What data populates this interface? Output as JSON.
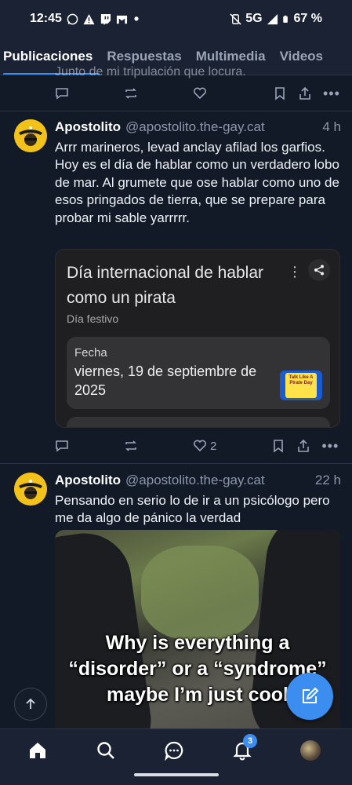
{
  "status_bar": {
    "time": "12:45",
    "network": "5G",
    "battery": "67 %"
  },
  "tabs": [
    "Publicaciones",
    "Respuestas",
    "Multimedia",
    "Videos"
  ],
  "previous_post": {
    "partial_text": "Junto de mi tripulación que locura."
  },
  "posts": [
    {
      "author": "Apostolito",
      "handle": "@apostolito.the-gay.cat",
      "time": "4 h",
      "text": "Arrr marineros, levad anclay afilad los garfios. Hoy es el día de hablar como un verdadero lobo de mar. Al grumete que ose hablar como uno de esos pringados de tierra, que se prepare para probar mi sable yarrrrr.",
      "card": {
        "title": "Día internacional de hablar como un pirata",
        "subtitle": "Día festivo",
        "field_label": "Fecha",
        "field_value": "viernes, 19 de septiembre de 2025",
        "thumb_text": "Talk Like A Pirate Day"
      },
      "likes": "2"
    },
    {
      "author": "Apostolito",
      "handle": "@apostolito.the-gay.cat",
      "time": "22 h",
      "text": "Pensando en serio lo de ir a un psicólogo pero me da algo de pánico la verdad",
      "media_caption": "Why is everything a “disorder” or a “syndrome” maybe I’m just cool"
    }
  ],
  "nav": {
    "notifications_badge": "3"
  },
  "colors": {
    "background": "#121a28",
    "accent": "#3b8ef0",
    "bar": "#1b2233"
  }
}
